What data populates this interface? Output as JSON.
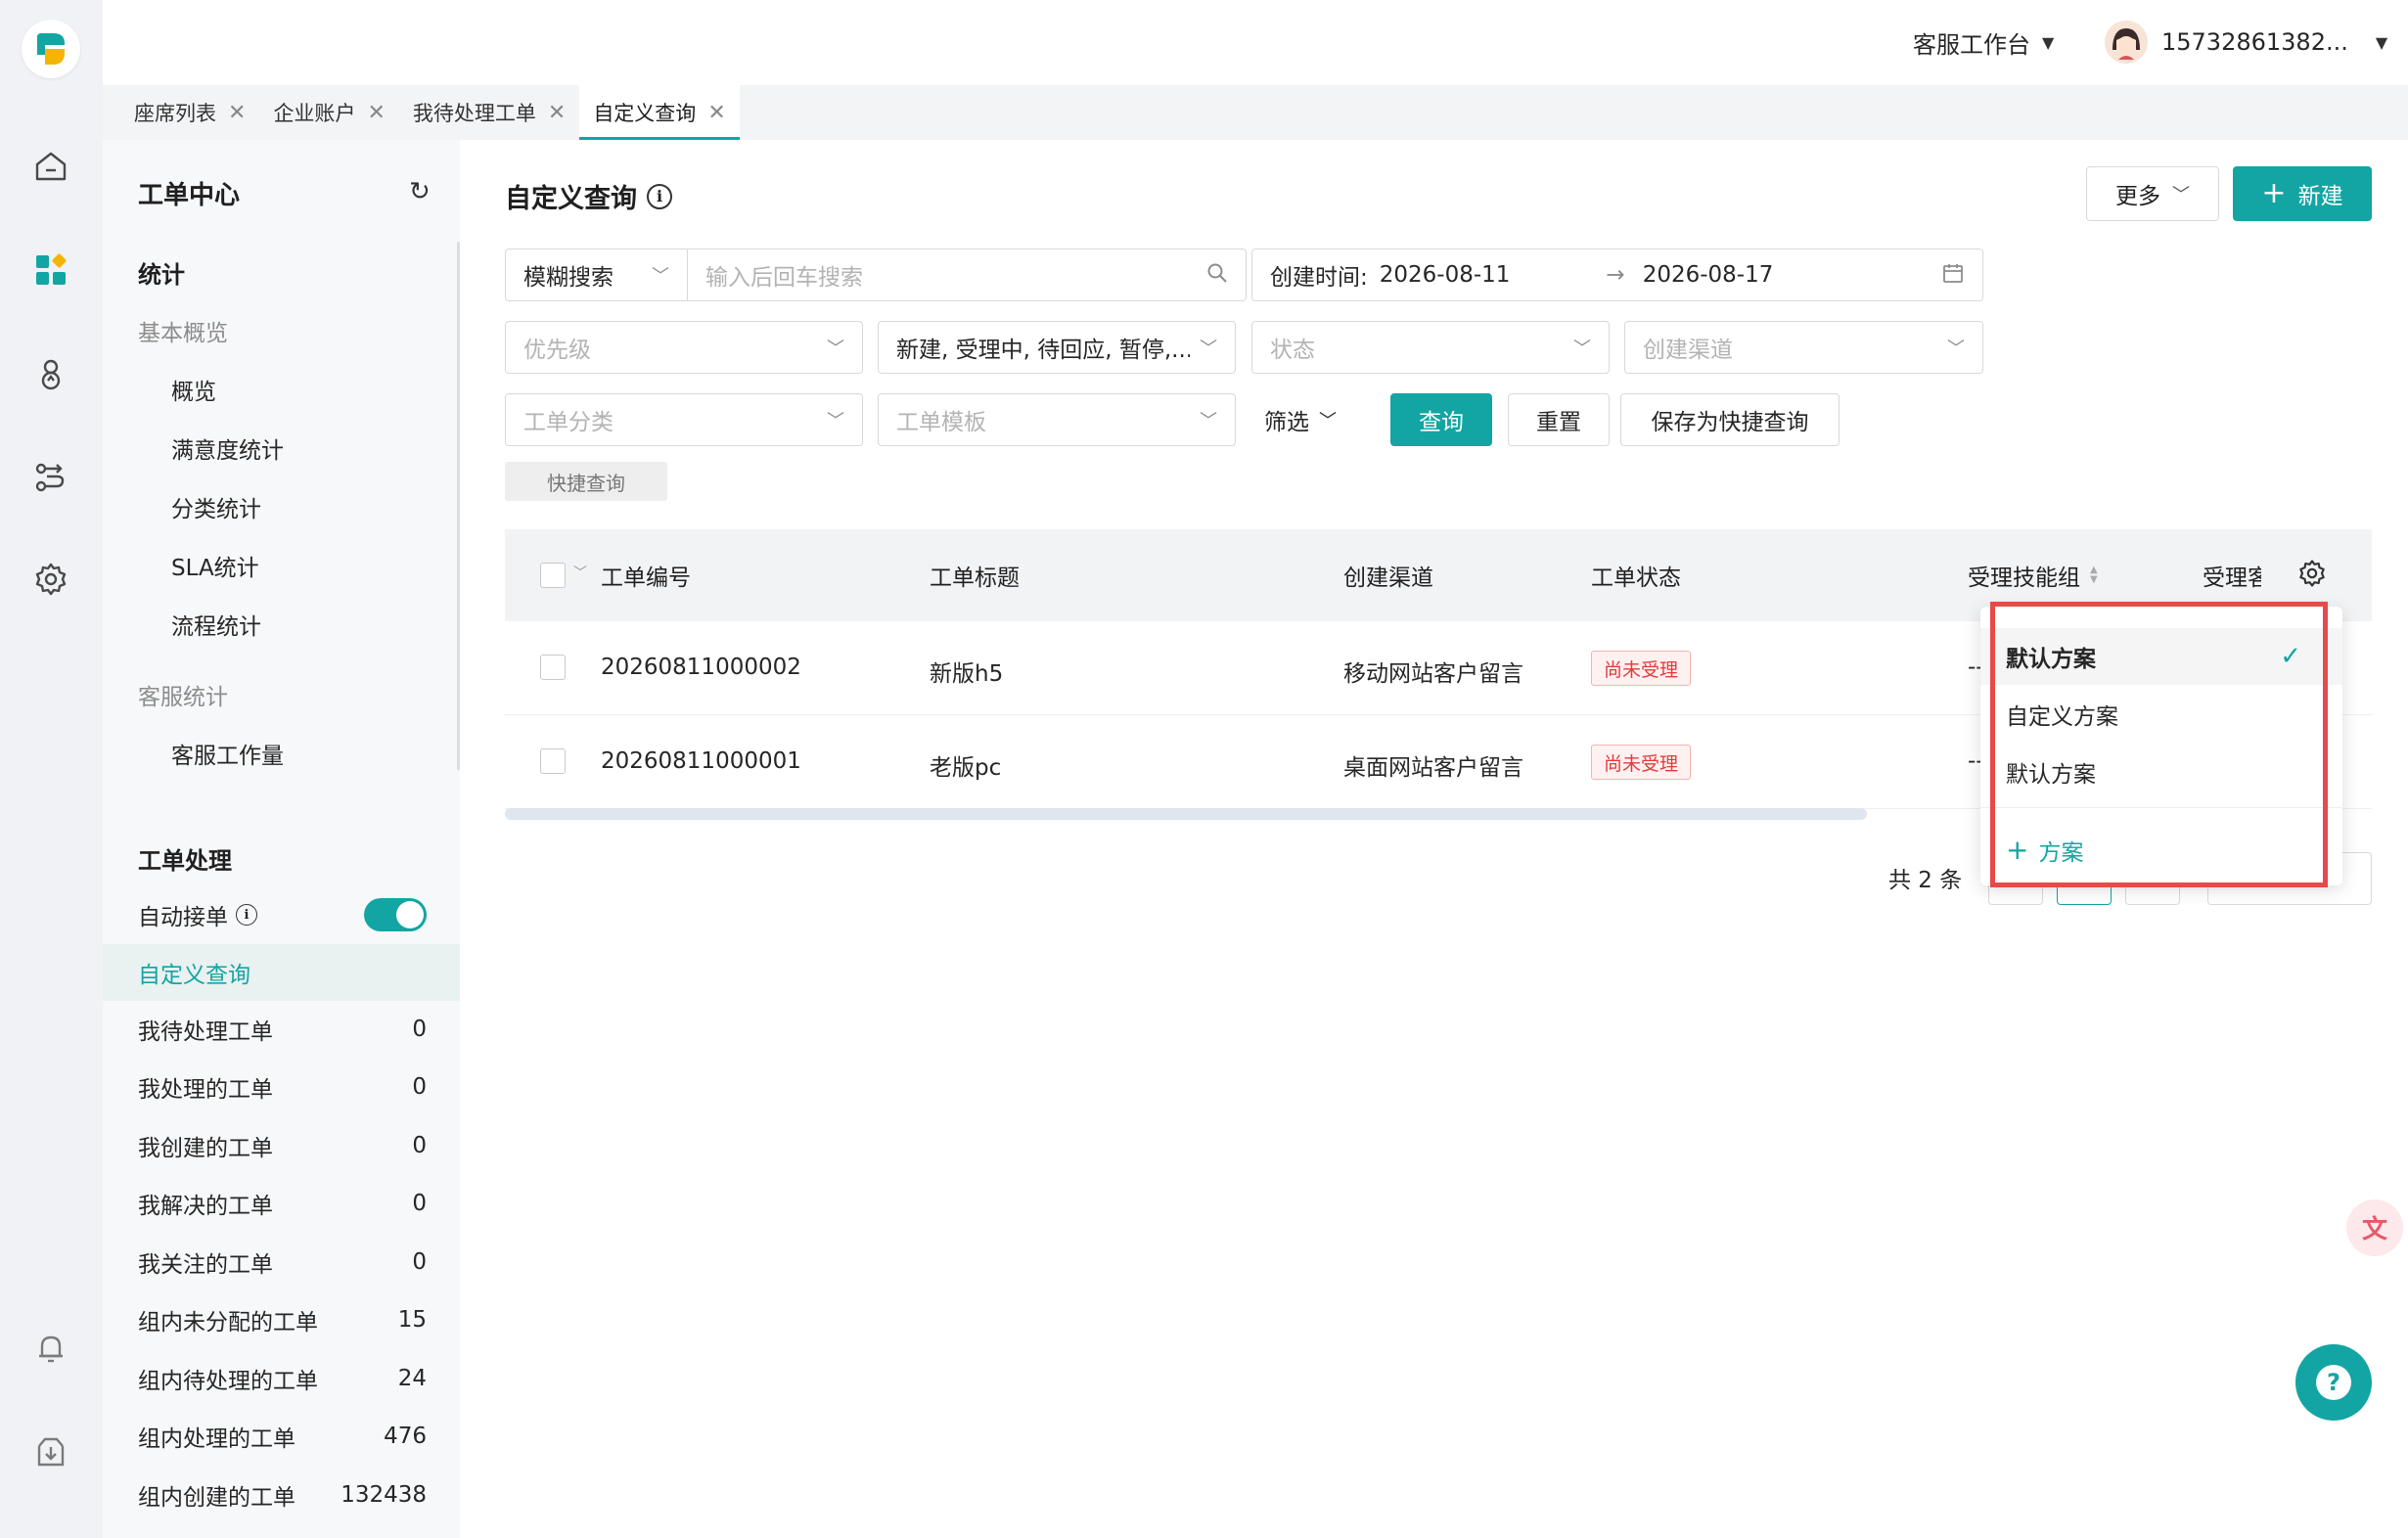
{
  "header": {
    "workspace_label": "客服工作台",
    "user_phone": "15732861382..."
  },
  "tabs": [
    {
      "label": "座席列表"
    },
    {
      "label": "企业账户"
    },
    {
      "label": "我待处理工单"
    },
    {
      "label": "自定义查询"
    }
  ],
  "sidebar": {
    "title": "工单中心",
    "stats_heading": "统计",
    "overview_group": "基本概览",
    "overview_items": [
      "概览",
      "满意度统计",
      "分类统计",
      "SLA统计",
      "流程统计"
    ],
    "cs_group": "客服统计",
    "cs_items": [
      "客服工作量"
    ],
    "processing_heading": "工单处理",
    "auto_accept_label": "自动接单",
    "items": [
      {
        "label": "自定义查询",
        "count": ""
      },
      {
        "label": "我待处理工单",
        "count": "0"
      },
      {
        "label": "我处理的工单",
        "count": "0"
      },
      {
        "label": "我创建的工单",
        "count": "0"
      },
      {
        "label": "我解决的工单",
        "count": "0"
      },
      {
        "label": "我关注的工单",
        "count": "0"
      },
      {
        "label": "组内未分配的工单",
        "count": "15"
      },
      {
        "label": "组内待处理的工单",
        "count": "24"
      },
      {
        "label": "组内处理的工单",
        "count": "476"
      },
      {
        "label": "组内创建的工单",
        "count": "132438"
      }
    ]
  },
  "main": {
    "title": "自定义查询",
    "more_label": "更多",
    "new_label": "新建",
    "filters": {
      "search_type": "模糊搜索",
      "search_placeholder": "输入后回车搜索",
      "created_time_label": "创建时间:",
      "date_start": "2026-08-11",
      "date_end": "2026-08-17",
      "priority_placeholder": "优先级",
      "status_value": "新建, 受理中, 待回应, 暂停,...",
      "state_placeholder": "状态",
      "channel_placeholder": "创建渠道",
      "category_placeholder": "工单分类",
      "template_placeholder": "工单模板",
      "filter_label": "筛选",
      "query_label": "查询",
      "reset_label": "重置",
      "save_quick_label": "保存为快捷查询",
      "quick_query_tag": "快捷查询"
    },
    "table": {
      "columns": [
        "工单编号",
        "工单标题",
        "创建渠道",
        "工单状态",
        "受理技能组",
        "受理客"
      ],
      "rows": [
        {
          "id": "20260811000002",
          "title": "新版h5",
          "channel": "移动网站客户留言",
          "status": "尚未受理",
          "group": "--"
        },
        {
          "id": "20260811000001",
          "title": "老版pc",
          "channel": "桌面网站客户留言",
          "status": "尚未受理",
          "group": "--"
        }
      ]
    },
    "pagination": {
      "total": "共 2 条"
    }
  },
  "scheme_dropdown": {
    "items": [
      "默认方案",
      "自定义方案",
      "默认方案"
    ],
    "selected_index": 0,
    "add_label": "方案"
  },
  "colors": {
    "accent": "#12a5a3",
    "highlight": "#e84a4a"
  }
}
